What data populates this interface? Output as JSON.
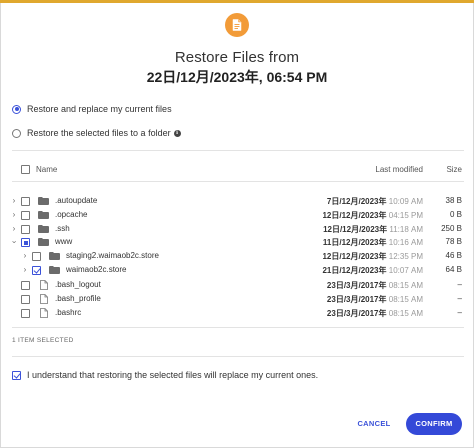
{
  "dialog": {
    "title_line1": "Restore Files from",
    "title_line2": "22日/12月/2023年, 06:54 PM",
    "accent_color": "#f29b38",
    "primary_color": "#3449d8"
  },
  "options": {
    "replace_label": "Restore and replace my current files",
    "folder_label": "Restore the selected files to a folder",
    "selected_option": "replace"
  },
  "table": {
    "col_name": "Name",
    "col_modified": "Last modified",
    "col_size": "Size",
    "rows": [
      {
        "name": ".autoupdate",
        "type": "folder",
        "date": "7日/12月/2023年",
        "time": "10:09 AM",
        "size": "38 B",
        "checked": false,
        "expanded": false
      },
      {
        "name": ".opcache",
        "type": "folder",
        "date": "12日/12月/2023年",
        "time": "04:15 PM",
        "size": "0 B",
        "checked": false,
        "expanded": false
      },
      {
        "name": ".ssh",
        "type": "folder",
        "date": "12日/12月/2023年",
        "time": "11:18 AM",
        "size": "250 B",
        "checked": false,
        "expanded": false
      },
      {
        "name": "www",
        "type": "folder",
        "date": "11日/12月/2023年",
        "time": "10:16 AM",
        "size": "78 B",
        "checked": "partial",
        "expanded": true
      },
      {
        "name": "staging2.waimaob2c.store",
        "type": "folder",
        "date": "12日/12月/2023年",
        "time": "12:35 PM",
        "size": "46 B",
        "checked": false,
        "expanded": false
      },
      {
        "name": "waimaob2c.store",
        "type": "folder",
        "date": "21日/12月/2023年",
        "time": "10:07 AM",
        "size": "64 B",
        "checked": true,
        "expanded": false
      },
      {
        "name": ".bash_logout",
        "type": "file",
        "date": "23日/3月/2017年",
        "time": "08:15 AM",
        "size": "–",
        "checked": false
      },
      {
        "name": ".bash_profile",
        "type": "file",
        "date": "23日/3月/2017年",
        "time": "08:15 AM",
        "size": "–",
        "checked": false
      },
      {
        "name": ".bashrc",
        "type": "file",
        "date": "23日/3月/2017年",
        "time": "08:15 AM",
        "size": "–",
        "checked": false
      }
    ]
  },
  "selected_count": "1 ITEM SELECTED",
  "confirm_text": "I understand that restoring the selected files will replace my current ones.",
  "buttons": {
    "cancel": "CANCEL",
    "confirm": "CONFIRM"
  }
}
